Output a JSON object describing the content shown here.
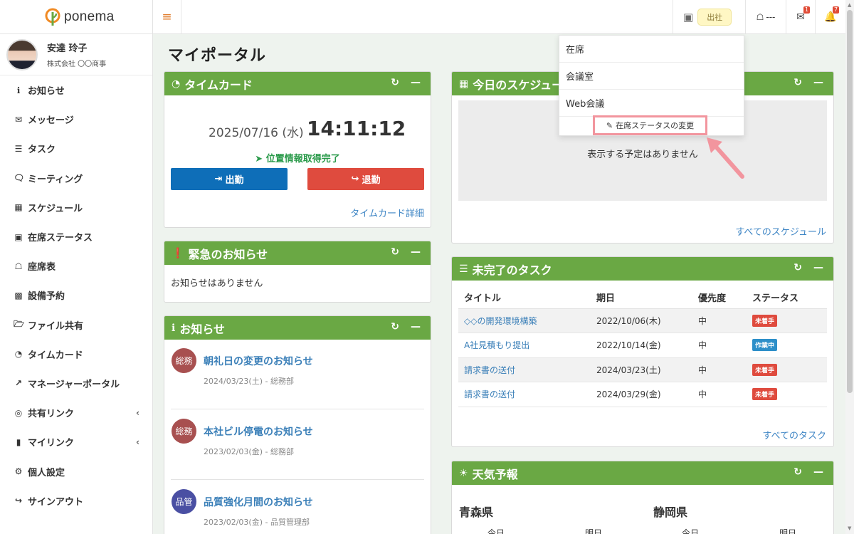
{
  "app": {
    "logo_text": "ponema"
  },
  "user": {
    "name": "安達 玲子",
    "company": "株式会社 〇〇商事"
  },
  "sidebar": {
    "items": [
      {
        "label": "お知らせ",
        "icon": "info-circle-icon"
      },
      {
        "label": "メッセージ",
        "icon": "envelope-icon"
      },
      {
        "label": "タスク",
        "icon": "tasks-icon"
      },
      {
        "label": "ミーティング",
        "icon": "comments-icon"
      },
      {
        "label": "スケジュール",
        "icon": "calendar-icon"
      },
      {
        "label": "在席ステータス",
        "icon": "presence-icon"
      },
      {
        "label": "座席表",
        "icon": "chair-icon"
      },
      {
        "label": "設備予約",
        "icon": "building-icon"
      },
      {
        "label": "ファイル共有",
        "icon": "folder-icon"
      },
      {
        "label": "タイムカード",
        "icon": "clock-icon"
      },
      {
        "label": "マネージャーポータル",
        "icon": "chart-icon"
      },
      {
        "label": "共有リンク",
        "icon": "globe-icon"
      },
      {
        "label": "マイリンク",
        "icon": "bookmark-icon"
      },
      {
        "label": "個人設定",
        "icon": "gear-icon"
      },
      {
        "label": "サインアウト",
        "icon": "sign-out-icon"
      }
    ]
  },
  "topbar": {
    "presence_label": "出社",
    "seat_label": "---",
    "mail_count": "1",
    "notification_count": "7"
  },
  "page": {
    "title": "マイポータル"
  },
  "timecard": {
    "title": "タイムカード",
    "date": "2025/07/16 (水)",
    "time": "14:11:12",
    "location_status": "位置情報取得完了",
    "clock_in_label": "出勤",
    "clock_out_label": "退勤",
    "detail_link": "タイムカード詳細"
  },
  "urgent": {
    "title": "緊急のお知らせ",
    "empty_text": "お知らせはありません"
  },
  "news": {
    "title": "お知らせ",
    "items": [
      {
        "badge": "総務",
        "badge_color": "#a85050",
        "title": "朝礼日の変更のお知らせ",
        "meta": "2024/03/23(土) - 総務部"
      },
      {
        "badge": "総務",
        "badge_color": "#a85050",
        "title": "本社ビル停電のお知らせ",
        "meta": "2023/02/03(金) - 総務部"
      },
      {
        "badge": "品管",
        "badge_color": "#4a4fa3",
        "title": "品質強化月間のお知らせ",
        "meta": "2023/02/03(金) - 品質管理部"
      }
    ]
  },
  "schedule": {
    "title": "今日のスケジュール",
    "empty_text": "表示する予定はありません",
    "all_link": "すべてのスケジュール"
  },
  "tasks": {
    "title": "未完了のタスク",
    "columns": [
      "タイトル",
      "期日",
      "優先度",
      "ステータス"
    ],
    "rows": [
      {
        "title": "◇◇の開発環境構築",
        "due": "2022/10/06(木)",
        "priority": "中",
        "status": "未着手",
        "status_color": "#df4b3e"
      },
      {
        "title": "A社見積もり提出",
        "due": "2022/10/14(金)",
        "priority": "中",
        "status": "作業中",
        "status_color": "#2d8fc9"
      },
      {
        "title": "請求書の送付",
        "due": "2024/03/23(土)",
        "priority": "中",
        "status": "未着手",
        "status_color": "#df4b3e"
      },
      {
        "title": "請求書の送付",
        "due": "2024/03/29(金)",
        "priority": "中",
        "status": "未着手",
        "status_color": "#df4b3e"
      }
    ],
    "all_link": "すべてのタスク"
  },
  "weather": {
    "title": "天気予報",
    "prefectures": [
      {
        "name": "青森県",
        "today": "今日",
        "tomorrow": "明日"
      },
      {
        "name": "静岡県",
        "today": "今日",
        "tomorrow": "明日"
      }
    ]
  },
  "presence_dropdown": {
    "options": [
      "在席",
      "会議室",
      "Web会議"
    ],
    "change_label": "在席ステータスの変更"
  },
  "colors": {
    "header_green": "#6aa844",
    "accent_orange": "#e07b2a",
    "clock_in_blue": "#0e6eb8",
    "clock_out_red": "#df4b3e",
    "highlight_pink": "#f2959e"
  }
}
